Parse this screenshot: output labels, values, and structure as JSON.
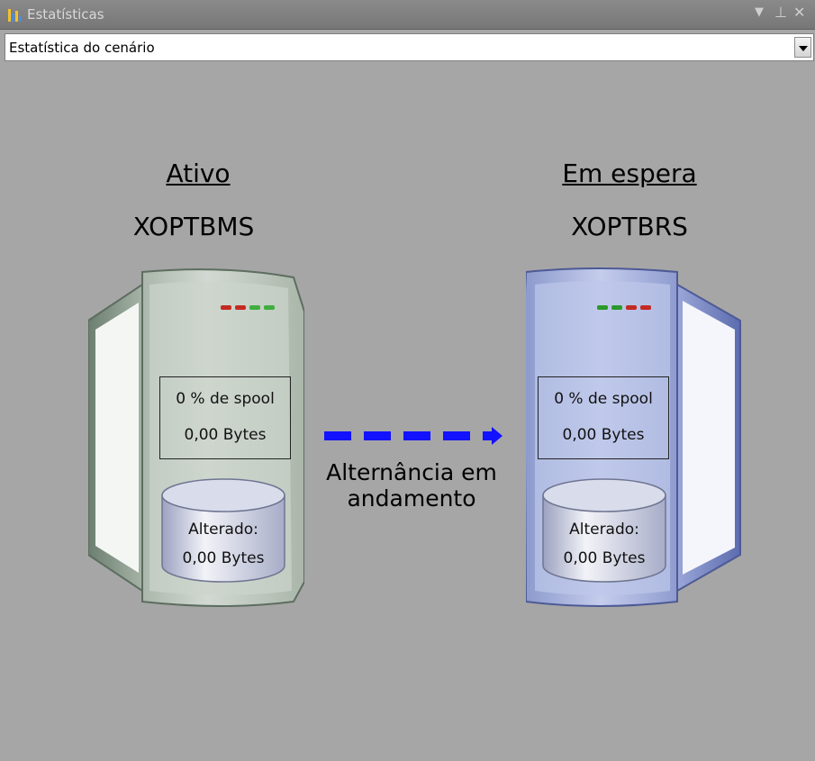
{
  "window": {
    "title": "Estatísticas",
    "controls": [
      "menu-arrow",
      "pin",
      "close"
    ]
  },
  "selector": {
    "value": "Estatística do cenário"
  },
  "active": {
    "role": "Ativo",
    "host": "XOPTBMS",
    "spool": "0 % de spool",
    "spool_bytes": "0,00 Bytes",
    "changed_label": "Alterado:",
    "changed_bytes": "0,00 Bytes",
    "leds": [
      "#c42a22",
      "#c42a22",
      "#3fae3f",
      "#3fae3f"
    ],
    "color": "#c3cbc4"
  },
  "standby": {
    "role": "Em espera",
    "host": "XOPTBRS",
    "spool": "0 % de spool",
    "spool_bytes": "0,00 Bytes",
    "changed_label": "Alterado:",
    "changed_bytes": "0,00 Bytes",
    "leds": [
      "#2a9a2a",
      "#2a9a2a",
      "#c42a22",
      "#c42a22"
    ],
    "color": "#b3bee0"
  },
  "replication": {
    "status": "Alternância em andamento",
    "arrow_color": "#1212ff"
  }
}
